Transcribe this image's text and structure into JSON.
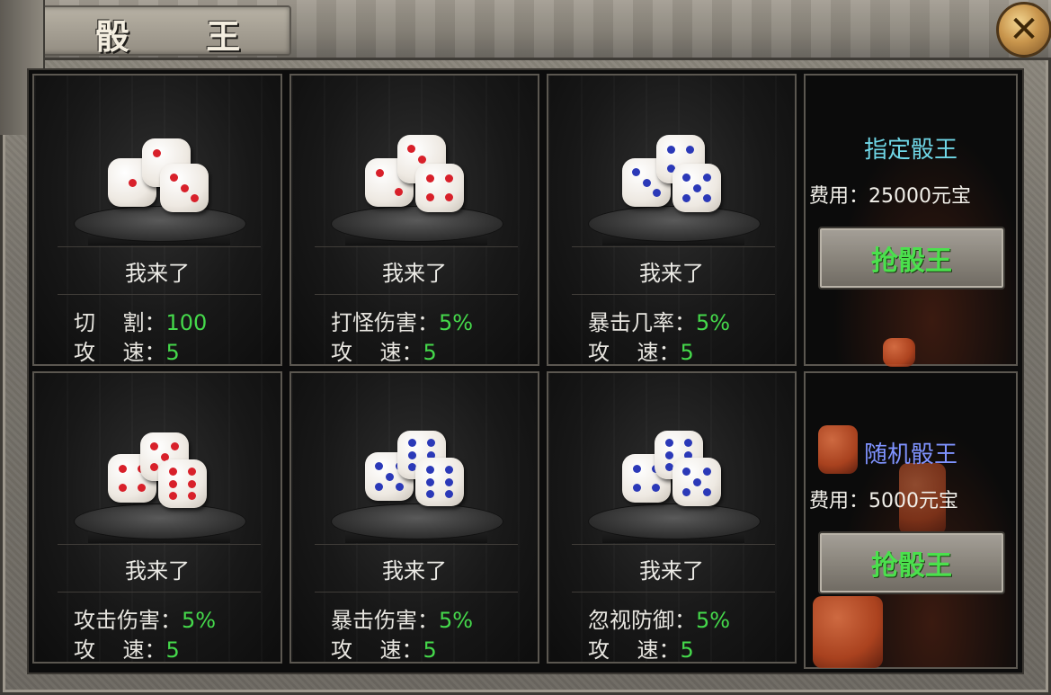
{
  "window": {
    "title": "骰 王"
  },
  "cards": [
    {
      "label": "我来了",
      "stats": [
        {
          "name": "切    割：",
          "value": "100"
        },
        {
          "name": "攻    速：",
          "value": "5"
        }
      ],
      "pips": "red"
    },
    {
      "label": "我来了",
      "stats": [
        {
          "name": "打怪伤害：",
          "value": "5%"
        },
        {
          "name": "攻    速：",
          "value": "5"
        }
      ],
      "pips": "red"
    },
    {
      "label": "我来了",
      "stats": [
        {
          "name": "暴击几率：",
          "value": "5%"
        },
        {
          "name": "攻    速：",
          "value": "5"
        }
      ],
      "pips": "blue"
    },
    {
      "label": "我来了",
      "stats": [
        {
          "name": "攻击伤害：",
          "value": "5%"
        },
        {
          "name": "攻    速：",
          "value": "5"
        }
      ],
      "pips": "red"
    },
    {
      "label": "我来了",
      "stats": [
        {
          "name": "暴击伤害：",
          "value": "5%"
        },
        {
          "name": "攻    速：",
          "value": "5"
        }
      ],
      "pips": "blue"
    },
    {
      "label": "我来了",
      "stats": [
        {
          "name": "忽视防御：",
          "value": "5%"
        },
        {
          "name": "攻    速：",
          "value": "5"
        }
      ],
      "pips": "blue"
    }
  ],
  "side_panels": [
    {
      "title": "指定骰王",
      "title_color": "#6fd6e6",
      "cost": "费用：25000元宝",
      "button": "抢骰王"
    },
    {
      "title": "随机骰王",
      "title_color": "#7f93ff",
      "cost": "费用：5000元宝",
      "button": "抢骰王"
    }
  ],
  "colors": {
    "value_green": "#45d94b",
    "pip_red": "#d8202a",
    "pip_blue": "#2b39b8"
  },
  "icons": {
    "close": "close-icon",
    "dice": "dice-icon"
  }
}
